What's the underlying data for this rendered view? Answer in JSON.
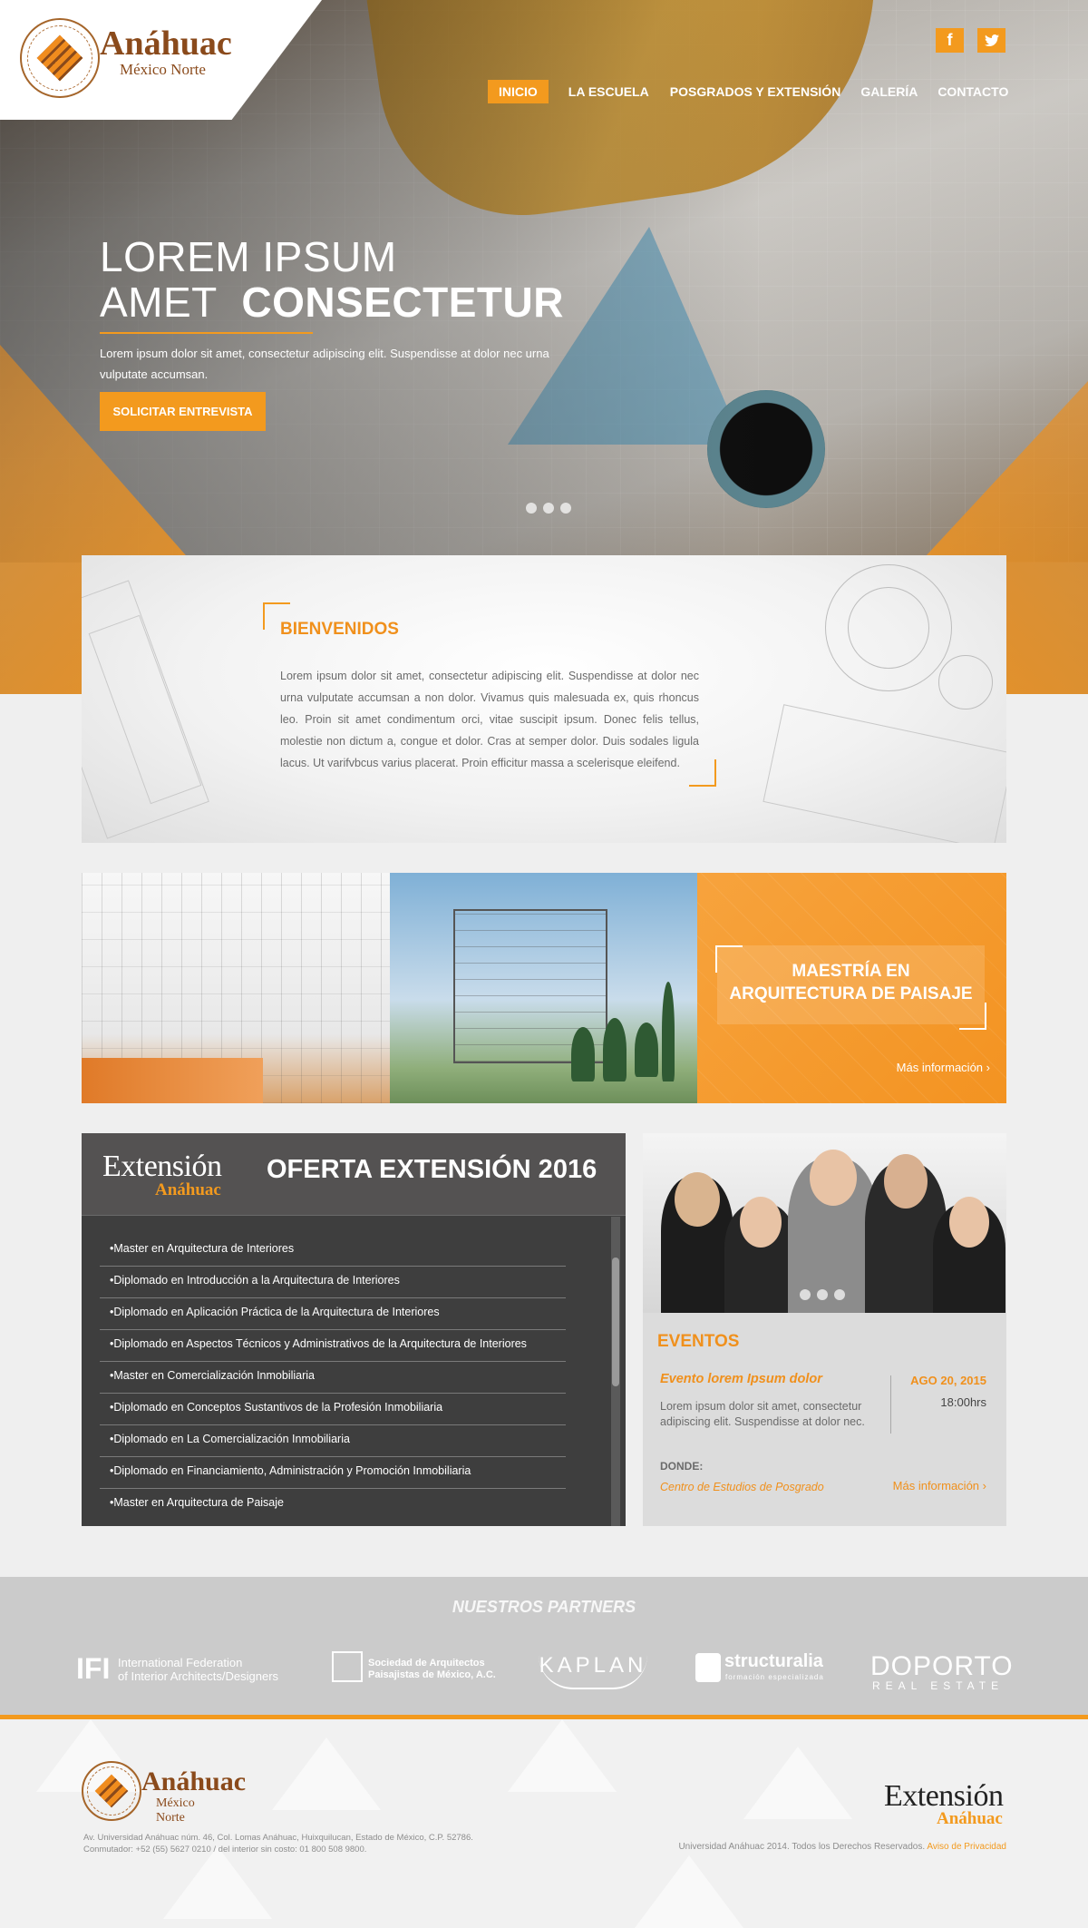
{
  "brand": {
    "name": "Anáhuac",
    "subtitle": "México Norte",
    "seal_text": "UNIVERSIDAD ANÁHUAC · VINCE IN BONO MALUM"
  },
  "social": {
    "facebook": "f",
    "twitter": "t"
  },
  "nav": [
    {
      "label": "INICIO",
      "active": true
    },
    {
      "label": "LA ESCUELA"
    },
    {
      "label": "POSGRADOS Y EXTENSIÓN"
    },
    {
      "label": "GALERÍA"
    },
    {
      "label": "CONTACTO"
    }
  ],
  "hero": {
    "title_line1": "LOREM IPSUM",
    "title_line2_light": "AMET",
    "title_line2_bold": "CONSECTETUR",
    "text": "Lorem ipsum dolor sit amet, consectetur adipiscing elit. Suspendisse at dolor nec urna vulputate accumsan.",
    "button": "SOLICITAR ENTREVISTA",
    "slides": 3
  },
  "welcome": {
    "title": "BIENVENIDOS",
    "text": "Lorem ipsum dolor sit amet, consectetur adipiscing elit. Suspendisse at dolor nec urna vulputate accumsan a non dolor. Vivamus quis malesuada ex, quis rhoncus leo. Proin sit amet condimentum orci, vitae suscipit ipsum. Donec felis tellus, molestie non dictum a, congue et dolor. Cras at semper dolor. Duis sodales ligula lacus. Ut varifvbcus varius placerat. Proin efficitur massa a scelerisque eleifend."
  },
  "promo": {
    "title_line1": "MAESTRÍA EN",
    "title_line2": "ARQUITECTURA DE PAISAJE",
    "more": "Más información"
  },
  "offer": {
    "logo_line1": "Extensión",
    "logo_line2": "Anáhuac",
    "title": "OFERTA EXTENSIÓN 2016",
    "items": [
      "•Master en Arquitectura de Interiores",
      "•Diplomado en Introducción a la Arquitectura de Interiores",
      "•Diplomado en Aplicación Práctica de la Arquitectura de Interiores",
      "•Diplomado en Aspectos Técnicos y Administrativos de la Arquitectura de Interiores",
      "•Master en Comercialización Inmobiliaria",
      "•Diplomado en Conceptos Sustantivos de la Profesión Inmobiliaria",
      "•Diplomado en La Comercialización Inmobiliaria",
      "•Diplomado en Financiamiento, Administración y Promoción Inmobiliaria",
      "•Master en Arquitectura de Paisaje"
    ]
  },
  "events": {
    "title": "EVENTOS",
    "event_name": "Evento lorem Ipsum dolor",
    "event_desc": "Lorem ipsum dolor sit amet, consectetur adipiscing elit. Suspendisse at dolor nec.",
    "date": "AGO 20, 2015",
    "time": "18:00hrs",
    "where_label": "DONDE:",
    "where": "Centro de Estudios de Posgrado",
    "more": "Más información",
    "slides": 3
  },
  "partners": {
    "title": "NUESTROS PARTNERS",
    "ifi_mark": "IFI",
    "ifi_line1": "International Federation",
    "ifi_line2": "of Interior Architects/Designers",
    "sapm_line1": "Sociedad de Arquitectos",
    "sapm_line2": "Paisajistas de México, A.C.",
    "kaplan": "KAPLAN",
    "structuralia": "structuralia",
    "structuralia_sub": "formación especializada",
    "doporto": "DOPORTO",
    "doporto_sub": "REAL ESTATE"
  },
  "footer": {
    "address_line1": "Av. Universidad Anáhuac núm. 46, Col. Lomas Anáhuac, Huixquilucan, Estado de México, C.P. 52786.",
    "address_line2": "Conmutador: +52 (55) 5627 0210 / del interior sin costo: 01 800 508 9800.",
    "copyright": "Universidad Anáhuac 2014. Todos los Derechos Reservados.",
    "privacy": "Aviso de Privacidad",
    "ext_line1": "Extensión",
    "ext_line2": "Anáhuac"
  },
  "colors": {
    "accent": "#f39a1e",
    "dark_panel": "#3e3e3e",
    "partners_bg": "#cbcbcb"
  }
}
